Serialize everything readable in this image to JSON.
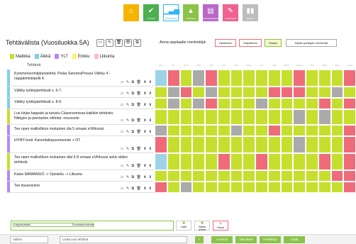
{
  "topbar": {
    "buttons": [
      {
        "label": "",
        "icon": "home-icon",
        "color": "#f5b400"
      },
      {
        "label": "Arviointi",
        "icon": "check-icon",
        "color": "#4caf50"
      },
      {
        "label": "Tehtävälistat",
        "icon": "chart-icon",
        "color": "#29b6f6"
      },
      {
        "label": "Tavoitteet",
        "icon": "triangle-icon",
        "color": "#8bc34a"
      },
      {
        "label": "Oppimispäiväkirjat",
        "icon": "book-icon",
        "color": "#ba68c8"
      },
      {
        "label": "Harjoitukset",
        "icon": "pencil-icon",
        "color": "#f06292"
      },
      {
        "label": "Raportit",
        "icon": "bars-icon",
        "color": "#bdbdbd"
      }
    ]
  },
  "header": {
    "title": "Tehtävälista (Vuosiluokka 5A)",
    "legend_label": "Anna oppilaalle merkintöjä:",
    "legend_buttons": [
      "Opettanen",
      "Harjoittelen",
      "Osaan"
    ],
    "show_teacher_btn": "Näytä opettajan merkinnät"
  },
  "subjects": [
    {
      "name": "Matikka",
      "color": "#c6df2e"
    },
    {
      "name": "Äikkä",
      "color": "#7fd0e8"
    },
    {
      "name": "YLT",
      "color": "#b388ff"
    },
    {
      "name": "Enkku",
      "color": "#fff176"
    },
    {
      "name": "Liikunta",
      "color": "#f8bbd0"
    }
  ],
  "column_header": "Tehtävä",
  "tasks": [
    {
      "text": "Kymmensormijärjestelmä: Pelaa SanomaProssa Välkky 4 - näppäimistöpelit 4.",
      "color": "#7fd0e8"
    },
    {
      "text": "Välkky työkirjatehtävät s. 6-7.",
      "color": "#7fd0e8"
    },
    {
      "text": "Välkky työkirjatehtävät s. 8-9.",
      "color": "#7fd0e8"
    },
    {
      "text": "Lue kirjan kappale ja tutustu Classroomissa kaikkiin tehtäviin. Niittyjen ja pientarten eliömiä -resurssiin",
      "color": "#c6df2e"
    },
    {
      "text": "Tee open mallivihkon mukainen dia 5 omaan eVihkoosi.",
      "color": "#b388ff"
    },
    {
      "text": "HYMY-tunti: Kaveritaitopuumoniste + OT",
      "color": "#b388ff"
    },
    {
      "text": "Tee open mallivihkon mukainen diat 6-8 omaan eVihkoosi sekä niiden tehtävät.",
      "color": "#c6df2e"
    },
    {
      "text": "Katso MAMAMUO -> Opiskelu -> Liikunta",
      "color": "#b388ff"
    },
    {
      "text": "Tee itsearviointi.",
      "color": "#b388ff"
    }
  ],
  "task_icons": "▭ ✎ ⧉ 🗑 ⬆ ⬇",
  "status_colors": {
    "G": "#c6df2e",
    "R": "#f06b7a",
    "B": "#9ed3e6",
    "Y": "#aaaaaa",
    "W": "#ffffff"
  },
  "grid": [
    "BRGYRGGGGGGRGGGR",
    "GYRGYGGGGRRRGGYG",
    "GYGYRGGGYGGGGRGR",
    "GGGGGGGGGGGYGYGG",
    "YGGGGGYGGRGGGGGR",
    "RGGGGGGGGGGYGGGR",
    "BGGGGRGGRGGGGRGR",
    "GGGGGGGGGGGGGGRR",
    "RGYGGGGGGGGGGGGR"
  ],
  "grid_headers": [
    "Aino",
    "Eli",
    "Emil",
    "Hilla",
    "Iida",
    "Into",
    "Juho",
    "Kaisu",
    "Leo",
    "Lilja",
    "Mikko",
    "Noora",
    "Otto",
    "Pihla",
    "Saga",
    "Veeti"
  ],
  "bottom": {
    "left_input": "Harjoitustaito",
    "mid_label": "Tunnistautuminen",
    "buttons": [
      {
        "label": "Lisää",
        "color": "#8bc34a"
      },
      {
        "label": "Vaihda aineet",
        "color": "#8bc34a"
      },
      {
        "label": "Poista",
        "color": "#f06b7a"
      }
    ]
  },
  "footer": {
    "select_value": "Valitse",
    "input_placeholder": "Lisää uusi tehtävä",
    "buttons": [
      "Arviointi",
      "Tavoitteet",
      "Päiväkirja",
      "Lisää"
    ]
  }
}
